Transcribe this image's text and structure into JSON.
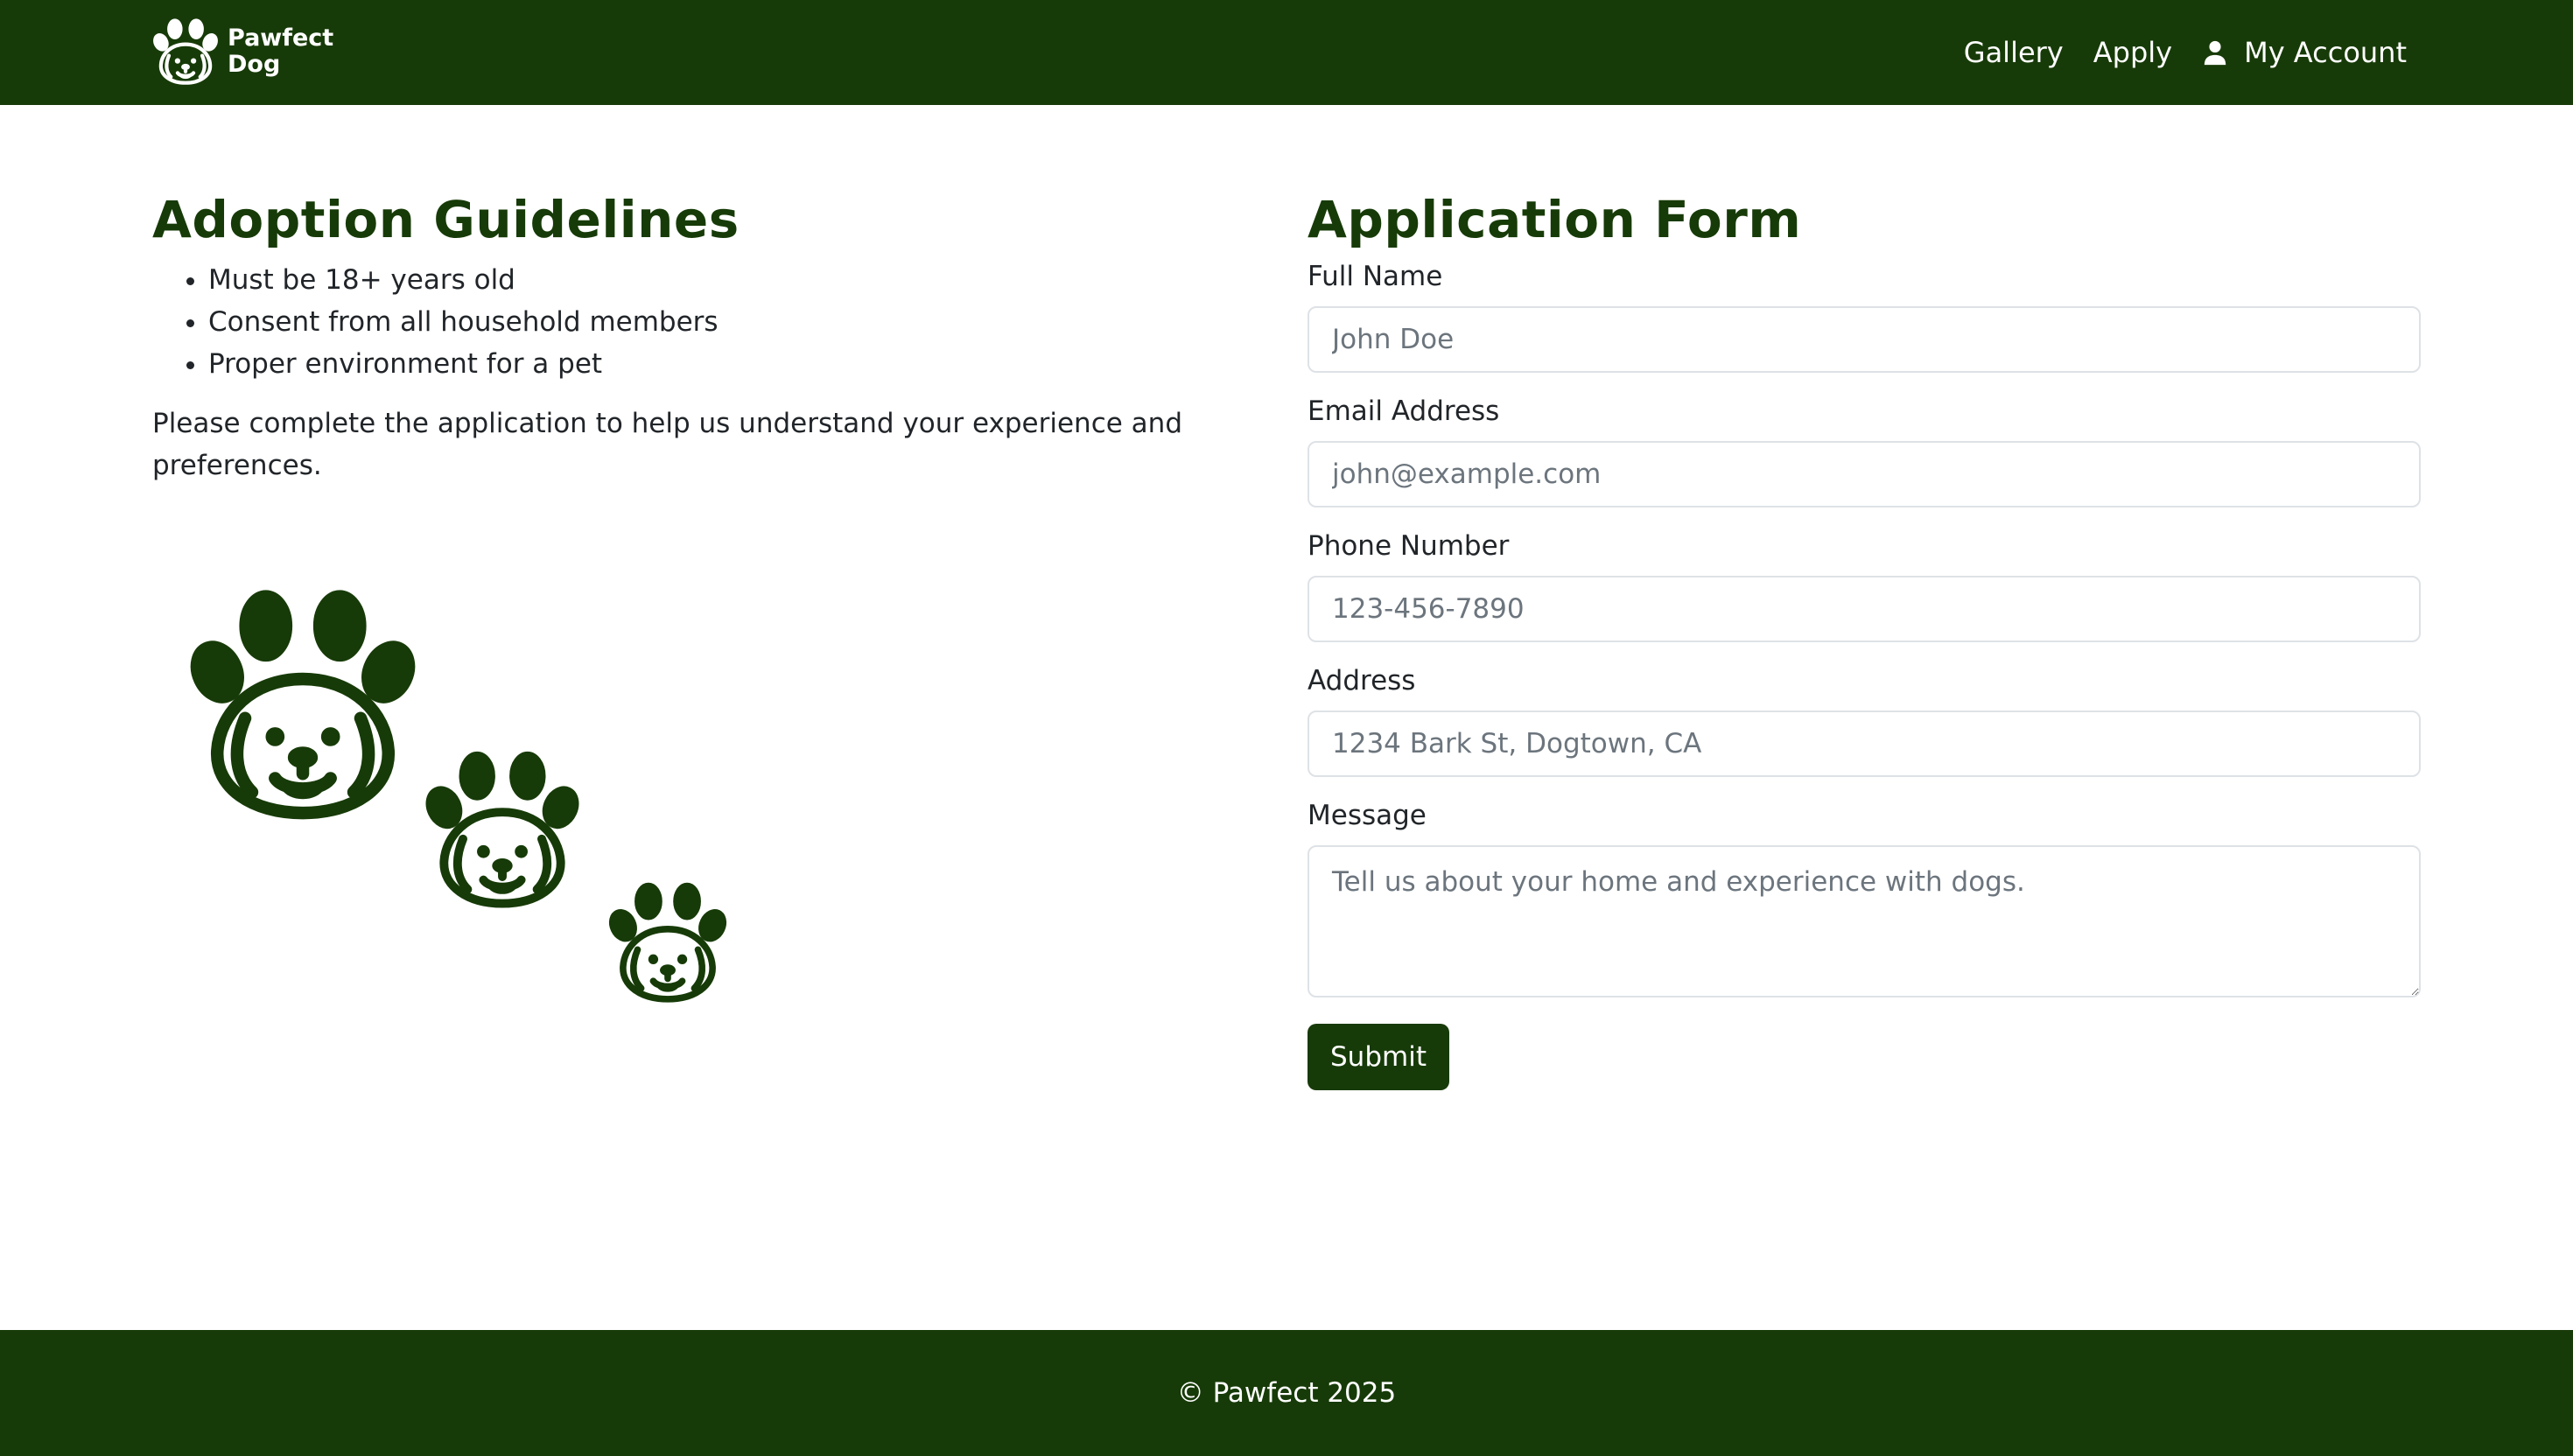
{
  "navbar": {
    "brand_line1": "Pawfect",
    "brand_line2": "Dog",
    "links": [
      {
        "label": "Gallery"
      },
      {
        "label": "Apply"
      },
      {
        "label": "My Account",
        "icon": "user-icon"
      }
    ]
  },
  "guidelines": {
    "title": "Adoption Guidelines",
    "items": [
      "Must be 18+ years old",
      "Consent from all household members",
      "Proper environment for a pet"
    ],
    "intro": "Please complete the application to help us understand your experience and preferences.",
    "illustration_icon": "dog-paw-icon"
  },
  "form": {
    "title": "Application Form",
    "fields": {
      "full_name": {
        "label": "Full Name",
        "placeholder": "John Doe"
      },
      "email": {
        "label": "Email Address",
        "placeholder": "john@example.com"
      },
      "phone": {
        "label": "Phone Number",
        "placeholder": "123-456-7890"
      },
      "address": {
        "label": "Address",
        "placeholder": "1234 Bark St, Dogtown, CA"
      },
      "message": {
        "label": "Message",
        "placeholder": "Tell us about your home and experience with dogs."
      }
    },
    "submit_label": "Submit"
  },
  "footer": {
    "text": "© Pawfect 2025"
  },
  "colors": {
    "primary": "#173b08",
    "text": "#212529",
    "placeholder": "#6c757d",
    "border": "#dee2e6"
  }
}
